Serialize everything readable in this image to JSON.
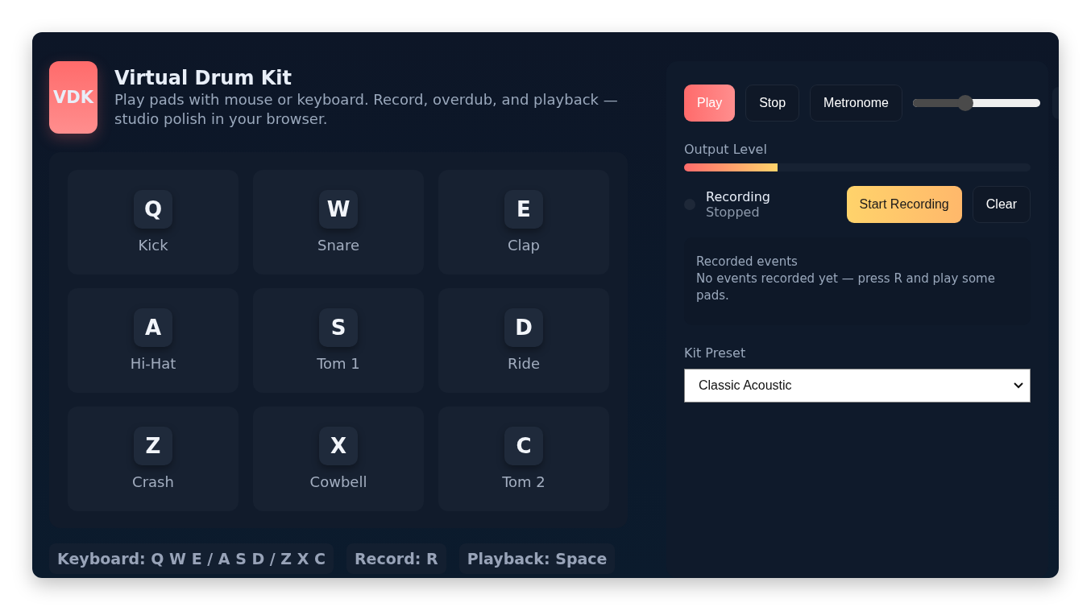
{
  "app": {
    "logo": "VDK",
    "title": "Virtual Drum Kit",
    "subtitle": "Play pads with mouse or keyboard. Record, overdub, and playback — studio polish in your browser."
  },
  "pads": [
    {
      "key": "Q",
      "name": "Kick"
    },
    {
      "key": "W",
      "name": "Snare"
    },
    {
      "key": "E",
      "name": "Clap"
    },
    {
      "key": "A",
      "name": "Hi-Hat"
    },
    {
      "key": "S",
      "name": "Tom 1"
    },
    {
      "key": "D",
      "name": "Ride"
    },
    {
      "key": "Z",
      "name": "Crash"
    },
    {
      "key": "X",
      "name": "Cowbell"
    },
    {
      "key": "C",
      "name": "Tom 2"
    }
  ],
  "hints": [
    "Keyboard: Q W E / A S D / Z X C",
    "Record: R",
    "Playback: Space"
  ],
  "transport": {
    "buttons": [
      {
        "label": "Play",
        "kind": "primary"
      },
      {
        "label": "Stop",
        "kind": "plain"
      },
      {
        "label": "Metronome",
        "kind": "plain"
      }
    ],
    "volume": {
      "level": 0.41
    }
  },
  "output": {
    "label": "Output Level",
    "level": 0.27
  },
  "recording": {
    "label": "Recording",
    "status": "Stopped",
    "active": false,
    "buttons": [
      {
        "label": "Start Recording",
        "kind": "accent"
      },
      {
        "label": "Clear",
        "kind": "plain"
      }
    ]
  },
  "events": {
    "title": "Recorded events",
    "empty": "No events recorded yet — press R and play some pads."
  },
  "preset": {
    "label": "Kit Preset",
    "value": "Classic Acoustic"
  }
}
